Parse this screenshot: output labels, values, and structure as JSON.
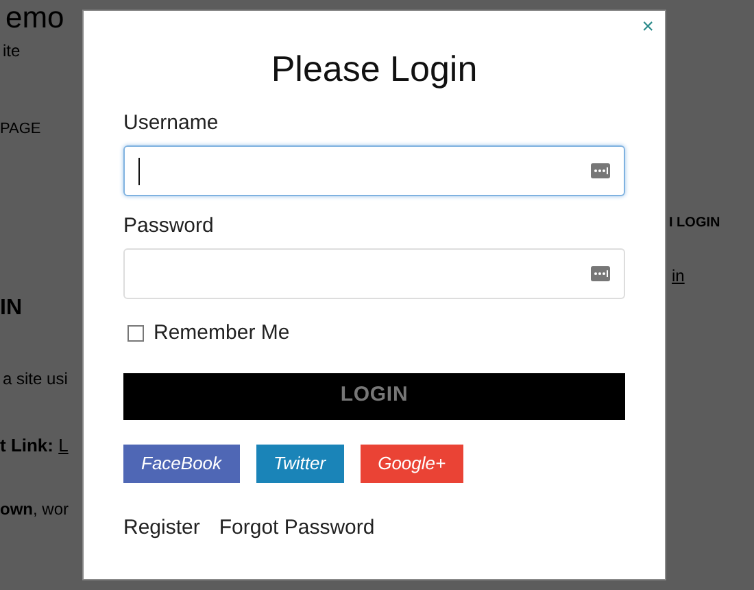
{
  "background_page": {
    "left": [
      {
        "kind": "heading",
        "text": "emo"
      },
      {
        "kind": "text",
        "text": "ite"
      },
      {
        "kind": "menu",
        "text": "PAGE"
      },
      {
        "kind": "title",
        "text": "IN"
      },
      {
        "kind": "text",
        "text": "a site usi"
      },
      {
        "kind": "bold",
        "text": "t Link: ",
        "link": "L"
      },
      {
        "kind": "mixed",
        "bold": "own",
        "text": ", wor"
      }
    ],
    "right": [
      {
        "kind": "title",
        "text": "I LOGIN"
      },
      {
        "kind": "link",
        "text": "in"
      }
    ]
  },
  "dialog": {
    "close": "×",
    "title": "Please Login",
    "fields": [
      {
        "label": "Username",
        "focused": true
      },
      {
        "label": "Password",
        "focused": false
      }
    ],
    "remember": {
      "label": "Remember Me",
      "checked": false
    },
    "submit": "LOGIN",
    "social": [
      {
        "label": "FaceBook",
        "color": "#4f67b5"
      },
      {
        "label": "Twitter",
        "color": "#1a84b8"
      },
      {
        "label": "Google+",
        "color": "#ea4335"
      }
    ],
    "links": [
      "Register",
      "Forgot Password"
    ]
  }
}
